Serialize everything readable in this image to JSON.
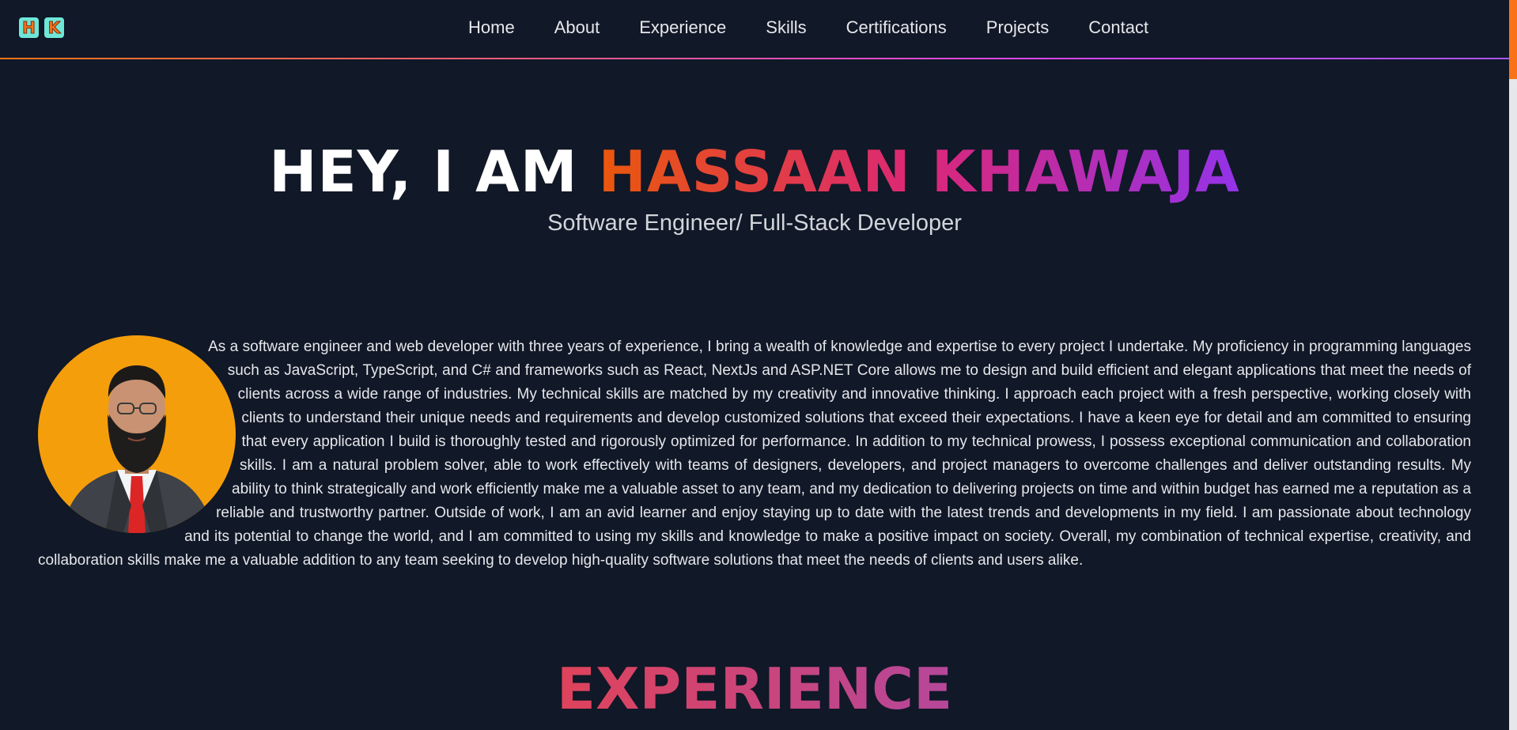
{
  "logo": {
    "letters": [
      "H",
      "K"
    ]
  },
  "nav": {
    "links": [
      "Home",
      "About",
      "Experience",
      "Skills",
      "Certifications",
      "Projects",
      "Contact"
    ]
  },
  "hero": {
    "greeting": "HEY, I AM ",
    "name": "HASSAAN KHAWAJA",
    "subtitle": "Software Engineer/ Full-Stack Developer"
  },
  "about": {
    "text": "As a software engineer and web developer with three years of experience, I bring a wealth of knowledge and expertise to every project I undertake. My proficiency in programming languages such as JavaScript, TypeScript, and C# and frameworks such as React, NextJs and ASP.NET Core allows me to design and build efficient and elegant applications that meet the needs of clients across a wide range of industries. My technical skills are matched by my creativity and innovative thinking. I approach each project with a fresh perspective, working closely with clients to understand their unique needs and requirements and develop customized solutions that exceed their expectations. I have a keen eye for detail and am committed to ensuring that every application I build is thoroughly tested and rigorously optimized for performance. In addition to my technical prowess, I possess exceptional communication and collaboration skills. I am a natural problem solver, able to work effectively with teams of designers, developers, and project managers to overcome challenges and deliver outstanding results. My ability to think strategically and work efficiently make me a valuable asset to any team, and my dedication to delivering projects on time and within budget has earned me a reputation as a reliable and trustworthy partner. Outside of work, I am an avid learner and enjoy staying up to date with the latest trends and developments in my field. I am passionate about technology and its potential to change the world, and I am committed to using my skills and knowledge to make a positive impact on society. Overall, my combination of technical expertise, creativity, and collaboration skills make me a valuable addition to any team seeking to develop high-quality software solutions that meet the needs of clients and users alike."
  },
  "experience": {
    "title": "EXPERIENCE"
  },
  "colors": {
    "background": "#111827",
    "accent_orange": "#ea580c",
    "accent_purple": "#9333ea",
    "avatar_bg": "#f59e0b"
  }
}
